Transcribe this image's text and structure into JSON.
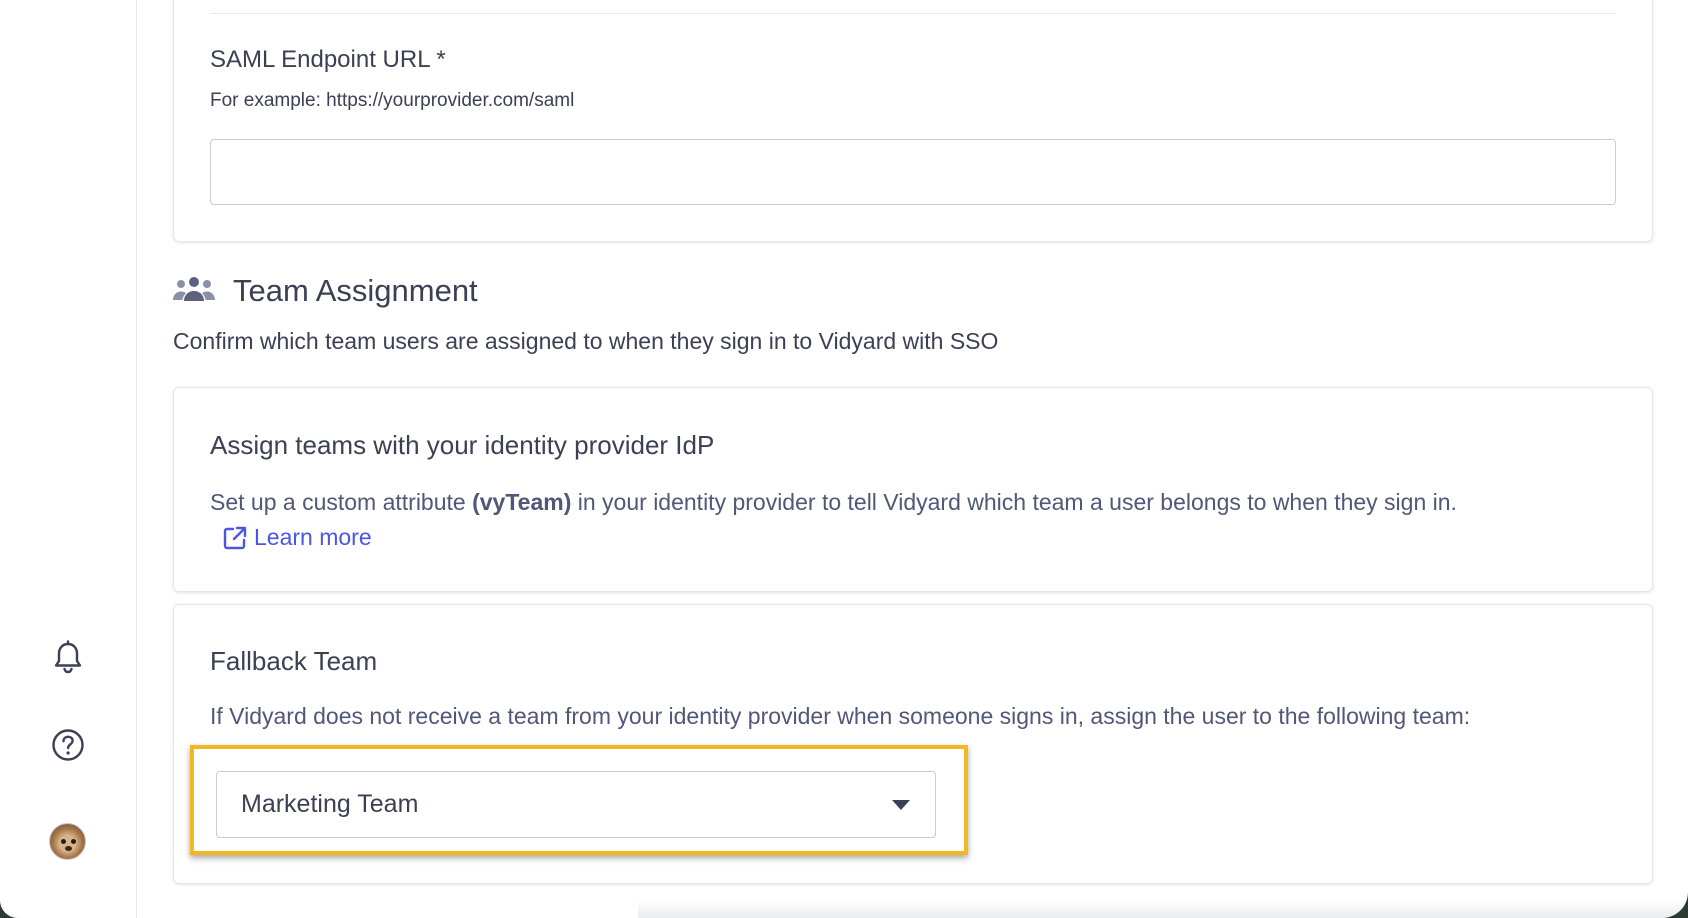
{
  "saml": {
    "label": "SAML Endpoint URL *",
    "hint": "For example: https://yourprovider.com/saml",
    "value": ""
  },
  "team_assignment": {
    "title": "Team Assignment",
    "subtitle": "Confirm which team users are assigned to when they sign in to Vidyard with SSO",
    "icon": "team-users-icon"
  },
  "idp_card": {
    "title": "Assign teams with your identity provider IdP",
    "text_before": "Set up a custom attribute ",
    "attribute": "(vyTeam)",
    "text_after": " in your identity provider to tell Vidyard which team a user belongs to when they sign in.",
    "learn_more": "Learn more"
  },
  "fallback_card": {
    "title": "Fallback Team",
    "text": "If Vidyard does not receive a team from your identity provider when someone signs in, assign the user to the following team:",
    "selected_team": "Marketing Team"
  },
  "sidebar": {
    "icons": [
      "bell-icon",
      "help-icon",
      "avatar"
    ]
  },
  "colors": {
    "accent_link": "#4a56e2",
    "highlight": "#f1b820",
    "text": "#3b4054"
  }
}
